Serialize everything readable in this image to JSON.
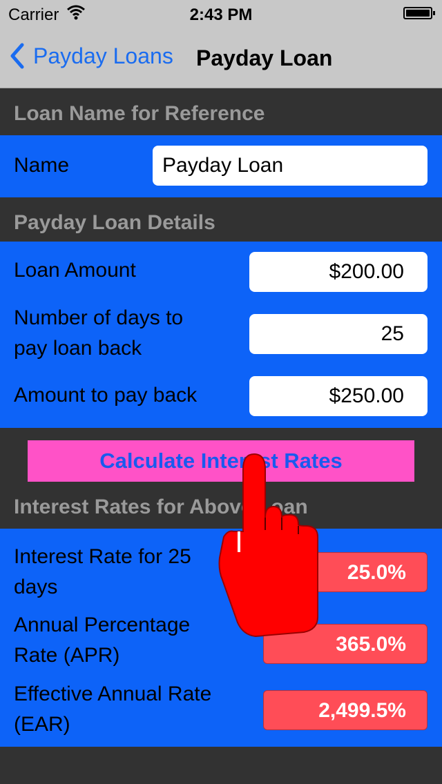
{
  "status": {
    "carrier": "Carrier",
    "time": "2:43 PM"
  },
  "nav": {
    "back_label": "Payday Loans",
    "title": "Payday Loan"
  },
  "section_reference": {
    "header": "Loan Name for Reference",
    "name_label": "Name",
    "name_value": "Payday Loan"
  },
  "section_details": {
    "header": "Payday Loan Details",
    "loan_amount_label": "Loan Amount",
    "loan_amount_value": "$200.00",
    "days_label_line1": "Number of days to",
    "days_label_line2": "pay loan back",
    "days_value": "25",
    "payback_label": "Amount to pay back",
    "payback_value": "$250.00"
  },
  "calculate_button": "Calculate Interest Rates",
  "section_rates": {
    "header": "Interest Rates for Above Loan",
    "rows": [
      {
        "label_line1": "Interest Rate for 25",
        "label_line2": "days",
        "value": "25.0%"
      },
      {
        "label_line1": "Annual Percentage",
        "label_line2": "Rate (APR)",
        "value": "365.0%"
      },
      {
        "label_line1": "Effective Annual Rate",
        "label_line2": "(EAR)",
        "value": "2,499.5%"
      }
    ]
  },
  "colors": {
    "section_bg": "#0d63f8",
    "button_bg": "#ff52c7",
    "result_bg": "#ff4d57",
    "nav_accent": "#1a6cf0"
  },
  "icons": {
    "back": "chevron-left-icon",
    "wifi": "wifi-icon",
    "battery": "battery-icon",
    "pointer": "hand-pointer-icon"
  }
}
